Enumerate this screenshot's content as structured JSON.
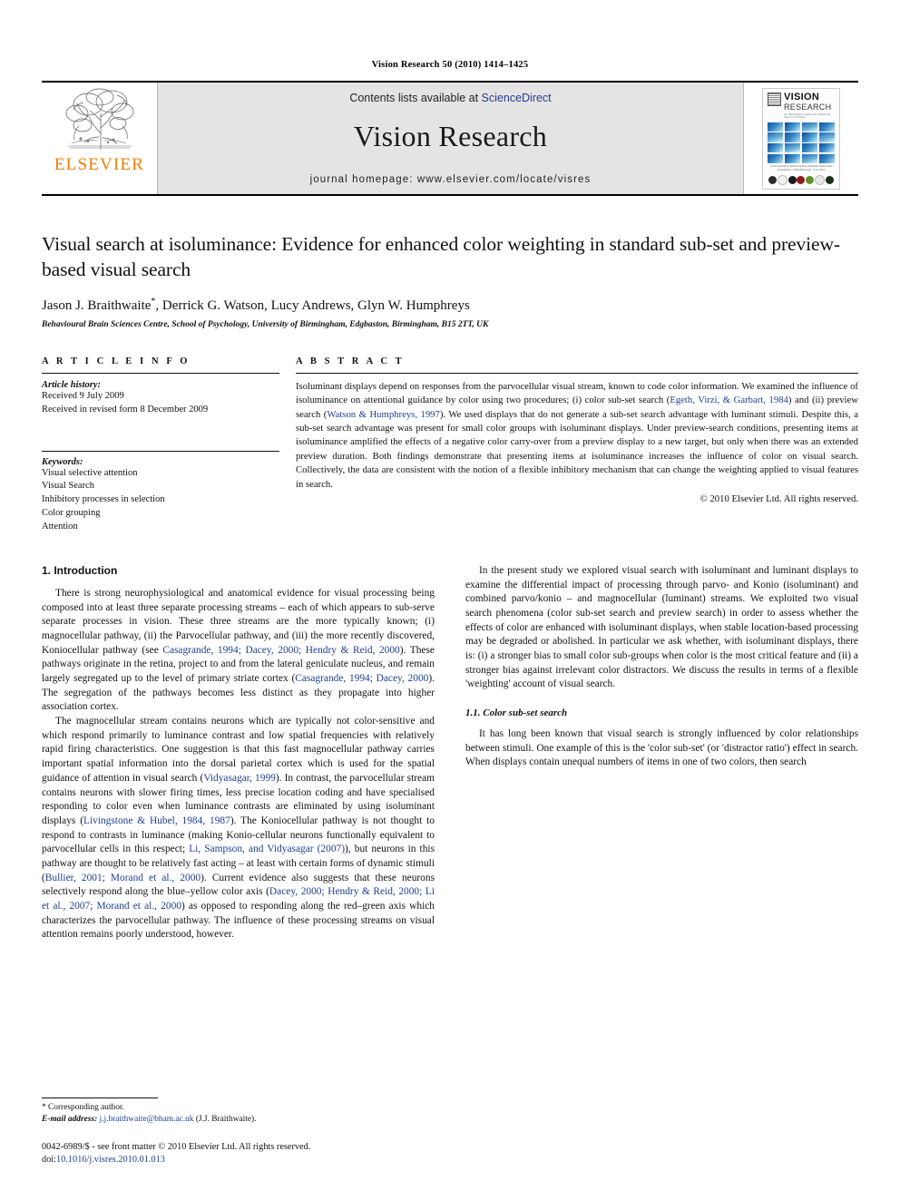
{
  "running_head": "Vision Research 50 (2010) 1414–1425",
  "masthead": {
    "publisher_name": "ELSEVIER",
    "contents_prefix": "Contents lists available at ",
    "sciencedirect": "ScienceDirect",
    "journal_name": "Vision Research",
    "homepage": "journal homepage: www.elsevier.com/locate/visres",
    "cover": {
      "title_line1": "VISION",
      "title_line2": "RESEARCH",
      "subtitle": "An International Journal for Functional Aspects of Vision",
      "caption": "Contrast Sensitivity, Spatial Frequency, Orientation Tuning\nVisual Psychophysics · Retinal Physiology · Color Vision",
      "dot_colors": [
        "#2b2b2b",
        "#f2f2f2",
        "#1a1a1a",
        "#8c1b1b",
        "#5f8f2a",
        "#e8e8e8",
        "#153015"
      ]
    }
  },
  "article": {
    "title": "Visual search at isoluminance: Evidence for enhanced color weighting in standard sub-set and preview-based visual search",
    "authors": "Jason J. Braithwaite",
    "authors_rest": ", Derrick G. Watson, Lucy Andrews, Glyn W. Humphreys",
    "corresponding_marker": "*",
    "affiliation": "Behavioural Brain Sciences Centre, School of Psychology, University of Birmingham, Edgbaston, Birmingham, B15 2TT, UK"
  },
  "article_info": {
    "heading": "A R T I C L E  I N F O",
    "history_label": "Article history:",
    "history": [
      "Received 9 July 2009",
      "Received in revised form 8 December 2009"
    ],
    "keywords_label": "Keywords:",
    "keywords": [
      "Visual selective attention",
      "Visual Search",
      "Inhibitory processes in selection",
      "Color grouping",
      "Attention"
    ]
  },
  "abstract": {
    "heading": "A B S T R A C T",
    "part1": "Isoluminant displays depend on responses from the parvocellular visual stream, known to code color information. We examined the influence of isoluminance on attentional guidance by color using two procedures; (i) color sub-set search (",
    "cite1": "Egeth, Virzi, & Garbart, 1984",
    "part2": ") and (ii) preview search (",
    "cite2": "Watson & Humphreys, 1997",
    "part3": "). We used displays that do not generate a sub-set search advantage with luminant stimuli. Despite this, a sub-set search advantage was present for small color groups with isoluminant displays. Under preview-search conditions, presenting items at isoluminance amplified the effects of a negative color carry-over from a preview display to a new target, but only when there was an extended preview duration. Both findings demonstrate that presenting items at isoluminance increases the influence of color on visual search. Collectively, the data are consistent with the notion of a flexible inhibitory mechanism that can change the weighting applied to visual features in search.",
    "copyright": "© 2010 Elsevier Ltd. All rights reserved."
  },
  "introduction": {
    "heading": "1. Introduction",
    "p1_a": "There is strong neurophysiological and anatomical evidence for visual processing being composed into at least three separate processing streams – each of which appears to sub-serve separate processes in vision. These three streams are the more typically known; (i) magnocellular pathway, (ii) the Parvocellular pathway, and (iii) the more recently discovered, Koniocellular pathway (see ",
    "p1_cite1": "Casagrande, 1994; Dacey, 2000; Hendry & Reid, 2000",
    "p1_b": "). These pathways originate in the retina, project to and from the lateral geniculate nucleus, and remain largely segregated up to the level of primary striate cortex (",
    "p1_cite2": "Casagrande, 1994; Dacey, 2000",
    "p1_c": "). The segregation of the pathways becomes less distinct as they propagate into higher association cortex.",
    "p2_a": "The magnocellular stream contains neurons which are typically not color-sensitive and which respond primarily to luminance contrast and low spatial frequencies with relatively rapid firing characteristics. One suggestion is that this fast magnocellular pathway carries important spatial information into the dorsal parietal cortex which is used for the spatial guidance of attention in visual search (",
    "p2_cite1": "Vidyasagar, 1999",
    "p2_b": "). In contrast, the parvocellular stream contains neurons with slower firing times, less precise location coding and have specialised responding to color even when luminance contrasts are eliminated by using isoluminant displays (",
    "p2_cite2": "Livingstone & Hubel, 1984, 1987",
    "p2_c": "). The Koniocellular pathway is not thought to respond to contrasts in luminance (making Konio-cellular neurons functionally equivalent to parvocellular cells in this respect; ",
    "p2_cite3": "Li, Sampson, and Vidyasagar (2007)",
    "p2_d": "), but neurons in this pathway are thought to be relatively fast acting – at least with certain forms of dynamic stimuli (",
    "p2_cite4": "Bullier, 2001; Morand et al., 2000",
    "p2_e": "). Current evidence also suggests that these neurons selectively respond along the blue–yellow color axis (",
    "p2_cite5": "Dacey, 2000; Hendry & Reid, 2000; Li et al., 2007; Morand et al., 2000",
    "p2_f": ") as opposed to responding along the red–green axis which characterizes the parvocellular pathway. The influence of these processing streams on visual attention remains poorly understood, however.",
    "p3": "In the present study we explored visual search with isoluminant and luminant displays to examine the differential impact of processing through parvo- and Konio (isoluminant) and combined parvo/konio – and magnocellular (luminant) streams. We exploited two visual search phenomena (color sub-set search and preview search) in order to assess whether the effects of color are enhanced with isoluminant displays, when stable location-based processing may be degraded or abolished. In particular we ask whether, with isoluminant displays, there is: (i) a stronger bias to small color sub-groups when color is the most critical feature and (ii) a stronger bias against irrelevant color distractors. We discuss the results in terms of a flexible 'weighting' account of visual search.",
    "subsection_heading": "1.1. Color sub-set search",
    "p4": "It has long been known that visual search is strongly influenced by color relationships between stimuli. One example of this is the 'color sub-set' (or 'distractor ratio') effect in search. When displays contain unequal numbers of items in one of two colors, then search"
  },
  "footnote": {
    "corresponding": "* Corresponding author.",
    "email_label": "E-mail address:",
    "email": "j.j.braithwaite@bham.ac.uk",
    "email_suffix": "(J.J. Braithwaite)."
  },
  "footer": {
    "issn_line": "0042-6989/$ - see front matter © 2010 Elsevier Ltd. All rights reserved.",
    "doi_label": "doi:",
    "doi": "10.1016/j.visres.2010.01.013"
  }
}
